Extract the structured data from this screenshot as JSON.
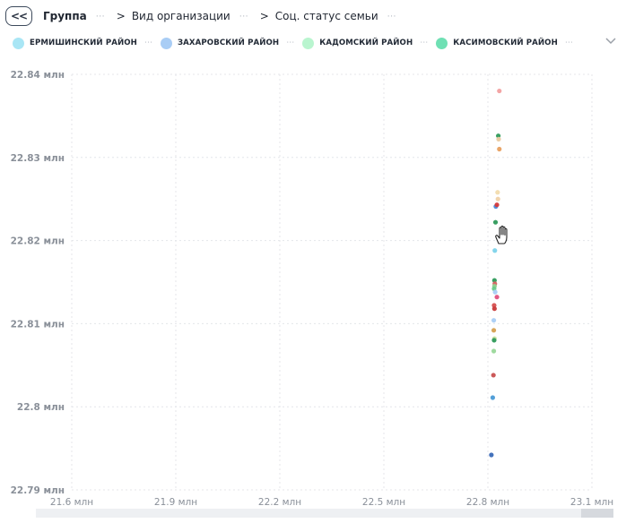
{
  "breadcrumb": {
    "back_label": "<<",
    "items": [
      {
        "label": "Группа",
        "bold": true
      },
      {
        "label": "Вид организации",
        "bold": false
      },
      {
        "label": "Соц. статус семьи",
        "bold": false
      }
    ],
    "separator": ">"
  },
  "legend": {
    "items": [
      {
        "label": "ЕРМИШИНСКИЙ РАЙОН",
        "color": "#a9e6f5"
      },
      {
        "label": "ЗАХАРОВСКИЙ РАЙОН",
        "color": "#a9cdf5"
      },
      {
        "label": "КАДОМСКИЙ РАЙОН",
        "color": "#b9f5cf"
      },
      {
        "label": "КАСИМОВСКИЙ РАЙОН",
        "color": "#6fe0b4"
      }
    ]
  },
  "chart_data": {
    "type": "scatter",
    "xlim": [
      21.6,
      23.1
    ],
    "ylim": [
      22.79,
      22.84
    ],
    "x_ticks": [
      {
        "value": 21.6,
        "label": "21.6 млн"
      },
      {
        "value": 21.9,
        "label": "21.9 млн"
      },
      {
        "value": 22.2,
        "label": "22.2 млн"
      },
      {
        "value": 22.5,
        "label": "22.5 млн"
      },
      {
        "value": 22.8,
        "label": "22.8 млн"
      },
      {
        "value": 23.1,
        "label": "23.1 млн"
      }
    ],
    "y_ticks": [
      {
        "value": 22.79,
        "label": "22.79 млн"
      },
      {
        "value": 22.8,
        "label": "22.8 млн"
      },
      {
        "value": 22.81,
        "label": "22.81 млн"
      },
      {
        "value": 22.82,
        "label": "22.82 млн"
      },
      {
        "value": 22.83,
        "label": "22.83 млн"
      },
      {
        "value": 22.84,
        "label": "22.84 млн"
      }
    ],
    "grid": true,
    "points": [
      {
        "x": 22.833,
        "y": 22.838,
        "color": "#f2a0a0"
      },
      {
        "x": 22.83,
        "y": 22.8326,
        "color": "#2e9a5a"
      },
      {
        "x": 22.831,
        "y": 22.8322,
        "color": "#e8c9a0"
      },
      {
        "x": 22.833,
        "y": 22.831,
        "color": "#e8a060"
      },
      {
        "x": 22.828,
        "y": 22.8258,
        "color": "#f2dcae"
      },
      {
        "x": 22.829,
        "y": 22.825,
        "color": "#f0d2a8"
      },
      {
        "x": 22.823,
        "y": 22.8241,
        "color": "#4a88d6"
      },
      {
        "x": 22.826,
        "y": 22.8243,
        "color": "#d63a3a"
      },
      {
        "x": 22.822,
        "y": 22.8222,
        "color": "#2e9a5a"
      },
      {
        "x": 22.82,
        "y": 22.8188,
        "color": "#7dd3ea"
      },
      {
        "x": 22.819,
        "y": 22.8152,
        "color": "#2e9a5a"
      },
      {
        "x": 22.82,
        "y": 22.8148,
        "color": "#d66060"
      },
      {
        "x": 22.819,
        "y": 22.8145,
        "color": "#8fd08f"
      },
      {
        "x": 22.818,
        "y": 22.8142,
        "color": "#6aca8a"
      },
      {
        "x": 22.821,
        "y": 22.8138,
        "color": "#a9cdf5"
      },
      {
        "x": 22.826,
        "y": 22.8132,
        "color": "#e05080"
      },
      {
        "x": 22.818,
        "y": 22.8122,
        "color": "#d65050"
      },
      {
        "x": 22.819,
        "y": 22.8118,
        "color": "#c83a3a"
      },
      {
        "x": 22.817,
        "y": 22.8104,
        "color": "#a9cdf5"
      },
      {
        "x": 22.817,
        "y": 22.8092,
        "color": "#d6a050"
      },
      {
        "x": 22.819,
        "y": 22.8082,
        "color": "#c8e0a0"
      },
      {
        "x": 22.818,
        "y": 22.808,
        "color": "#2e9a5a"
      },
      {
        "x": 22.817,
        "y": 22.8067,
        "color": "#9ad89a"
      },
      {
        "x": 22.816,
        "y": 22.8038,
        "color": "#c85050"
      },
      {
        "x": 22.814,
        "y": 22.8011,
        "color": "#4a9ad6"
      },
      {
        "x": 22.81,
        "y": 22.7942,
        "color": "#3a6ab8"
      }
    ]
  }
}
